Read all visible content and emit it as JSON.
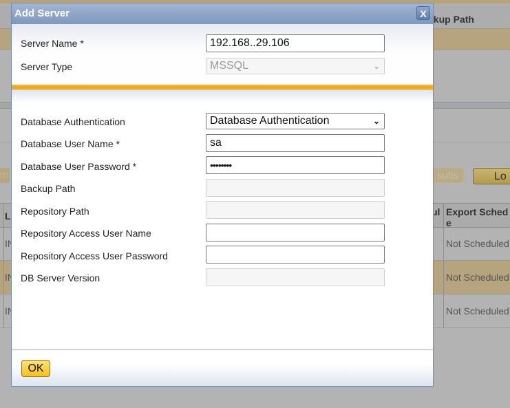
{
  "background": {
    "header_partial": "ckup Path",
    "buttons": {
      "results_partial": "sults",
      "left_partial": "m",
      "load_partial": "Lo"
    },
    "table": {
      "columns_partial": [
        "L",
        "ul",
        "Export Schedule"
      ],
      "export_schedule_header_line1": "Export Sched",
      "export_schedule_header_line2": "e",
      "rows": [
        {
          "left_partial": "IN",
          "export_schedule": "Not Scheduled"
        },
        {
          "left_partial": "IN",
          "export_schedule": "Not Scheduled"
        },
        {
          "left_partial": "IN",
          "export_schedule": "Not Scheduled"
        }
      ]
    }
  },
  "dialog": {
    "title": "Add Server",
    "close_label": "X",
    "fields": {
      "server_name": {
        "label": "Server Name *",
        "value": "192.168..29.106"
      },
      "server_type": {
        "label": "Server Type",
        "value": "MSSQL",
        "disabled": true
      },
      "db_auth": {
        "label": "Database Authentication",
        "value": "Database Authentication"
      },
      "db_user": {
        "label": "Database User Name *",
        "value": "sa"
      },
      "db_password": {
        "label": "Database User Password *",
        "value": "password"
      },
      "backup_path": {
        "label": "Backup Path",
        "value": "",
        "disabled": true
      },
      "repo_path": {
        "label": "Repository Path",
        "value": "",
        "disabled": true
      },
      "repo_user": {
        "label": "Repository Access User Name",
        "value": ""
      },
      "repo_password": {
        "label": "Repository Access User Password",
        "value": ""
      },
      "db_version": {
        "label": "DB Server Version",
        "value": "",
        "disabled": true
      }
    },
    "ok_label": "OK"
  },
  "colors": {
    "title_bar": "#8aa2c5",
    "accent_orange": "#f0ad2a",
    "ok_button": "#fbd247",
    "selected_row_bg": "#b5a47e"
  }
}
